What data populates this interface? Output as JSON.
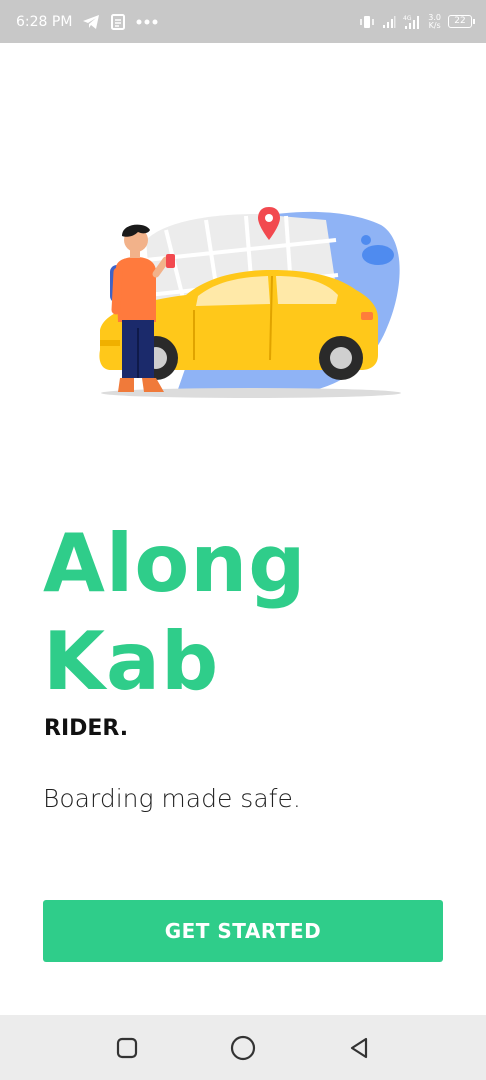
{
  "status_bar": {
    "time": "6:28 PM",
    "network_speed_value": "3.0",
    "network_speed_unit": "K/s",
    "battery": "22",
    "icons": [
      "telegram-icon",
      "news-icon",
      "more-dots-icon",
      "vibrate-icon",
      "signal-icon",
      "signal-4g-icon",
      "battery-icon"
    ]
  },
  "hero": {
    "image_name": "rider-with-taxi-illustration"
  },
  "brand": {
    "line1": "Along",
    "line2": "Kab",
    "subtitle": "RIDER.",
    "tagline": "Boarding made safe.",
    "accent_color": "#2fcd8a"
  },
  "cta": {
    "label": "GET STARTED"
  },
  "nav_bar": {
    "items": [
      "recents-square-icon",
      "home-circle-icon",
      "back-triangle-icon"
    ]
  }
}
